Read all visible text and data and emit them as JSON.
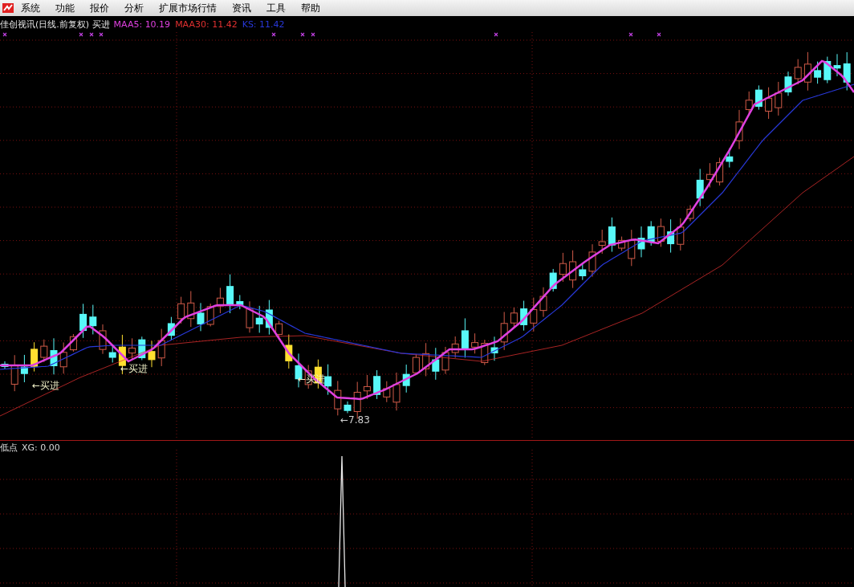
{
  "menu_bar": {
    "items": [
      "系统",
      "功能",
      "报价",
      "分析",
      "扩展市场行情",
      "资讯",
      "工具",
      "帮助"
    ]
  },
  "main_pane": {
    "title": "佳创视讯(日线.前复权) 买进",
    "indicators": [
      {
        "label": "MAA5: 10.19",
        "color": "#e040e0"
      },
      {
        "label": "MAA30: 11.42",
        "color": "#e03030"
      },
      {
        "label": "KS: 11.42",
        "color": "#2838d8"
      }
    ],
    "annotations": [
      "←买进",
      "←买进",
      "←买进",
      "←7.83"
    ]
  },
  "lower_pane": {
    "title": "低点",
    "indicators": [
      {
        "label": "XG: 0.00",
        "color": "#d8d8d8"
      }
    ]
  }
}
